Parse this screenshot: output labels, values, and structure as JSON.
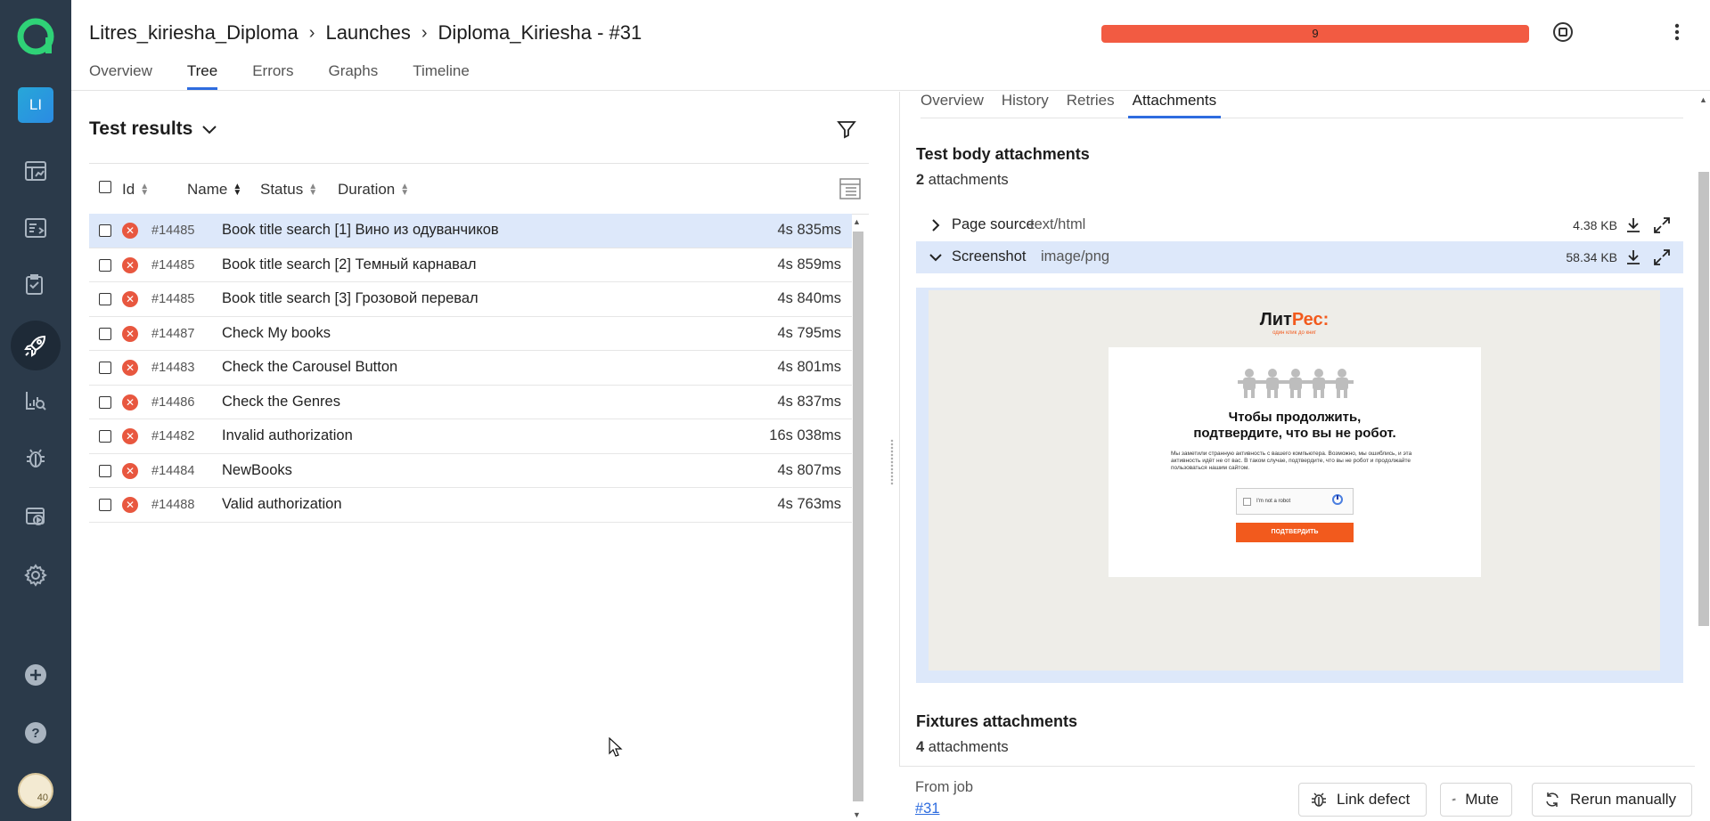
{
  "breadcrumb": [
    "Litres_kiriesha_Diploma",
    "Launches",
    "Diploma_Kiriesha - #31"
  ],
  "header_tabs": [
    "Overview",
    "Tree",
    "Errors",
    "Graphs",
    "Timeline"
  ],
  "active_header_tab": "Tree",
  "progress": {
    "label": "9",
    "color": "#f25b42",
    "fraction": 1.0
  },
  "sidebar": {
    "project_badge": "LI",
    "items": [
      "dashboards-icon",
      "test-cases-icon",
      "test-plans-icon",
      "launches-icon",
      "analytics-icon",
      "defects-icon",
      "jobs-icon",
      "settings-icon"
    ],
    "active": "launches-icon",
    "bottom": [
      "add-icon",
      "help-icon"
    ],
    "avatar_badge": "40"
  },
  "left": {
    "title": "Test results",
    "columns": [
      "Id",
      "Name",
      "Status",
      "Duration"
    ],
    "rows": [
      {
        "id": "#14485",
        "name": "Book title search [1] Вино из одуванчиков",
        "duration": "4s 835ms",
        "selected": true
      },
      {
        "id": "#14485",
        "name": "Book title search [2] Темный карнавал",
        "duration": "4s 859ms"
      },
      {
        "id": "#14485",
        "name": "Book title search [3] Грозовой перевал",
        "duration": "4s 840ms"
      },
      {
        "id": "#14487",
        "name": "Check My books",
        "duration": "4s 795ms"
      },
      {
        "id": "#14483",
        "name": "Check the Carousel Button",
        "duration": "4s 801ms"
      },
      {
        "id": "#14486",
        "name": "Check the Genres",
        "duration": "4s 837ms"
      },
      {
        "id": "#14482",
        "name": "Invalid authorization",
        "duration": "16s 038ms"
      },
      {
        "id": "#14484",
        "name": "NewBooks",
        "duration": "4s 807ms"
      },
      {
        "id": "#14488",
        "name": "Valid authorization",
        "duration": "4s 763ms"
      }
    ]
  },
  "right": {
    "tabs": [
      "Overview",
      "History",
      "Retries",
      "Attachments"
    ],
    "active_tab": "Attachments",
    "body": {
      "title": "Test body attachments",
      "count": "2",
      "count_label": "attachments",
      "items": [
        {
          "name": "Page source",
          "type": "text/html",
          "size": "4.38 KB",
          "open": false
        },
        {
          "name": "Screenshot",
          "type": "image/png",
          "size": "58.34 KB",
          "open": true
        }
      ]
    },
    "screenshot": {
      "logo_a": "Лит",
      "logo_b": "Рес:",
      "tagline": "один клик до книг",
      "heading_1": "Чтобы продолжить,",
      "heading_2": "подтвердите, что вы не робот.",
      "body": "Мы заметили странную активность с вашего компьютера. Возможно, мы ошиблись, и эта активность идёт не от вас. В таком случае, подтвердите, что вы не робот и продолжайте пользоваться нашим сайтом.",
      "captcha": "I'm not a robot",
      "button": "ПОДТВЕРДИТЬ"
    },
    "fixtures": {
      "title": "Fixtures attachments",
      "count": "4",
      "count_label": "attachments"
    },
    "footer": {
      "from_job": "From job",
      "job_link": "#31",
      "buttons": [
        "Link defect",
        "Mute",
        "Rerun manually"
      ]
    }
  }
}
